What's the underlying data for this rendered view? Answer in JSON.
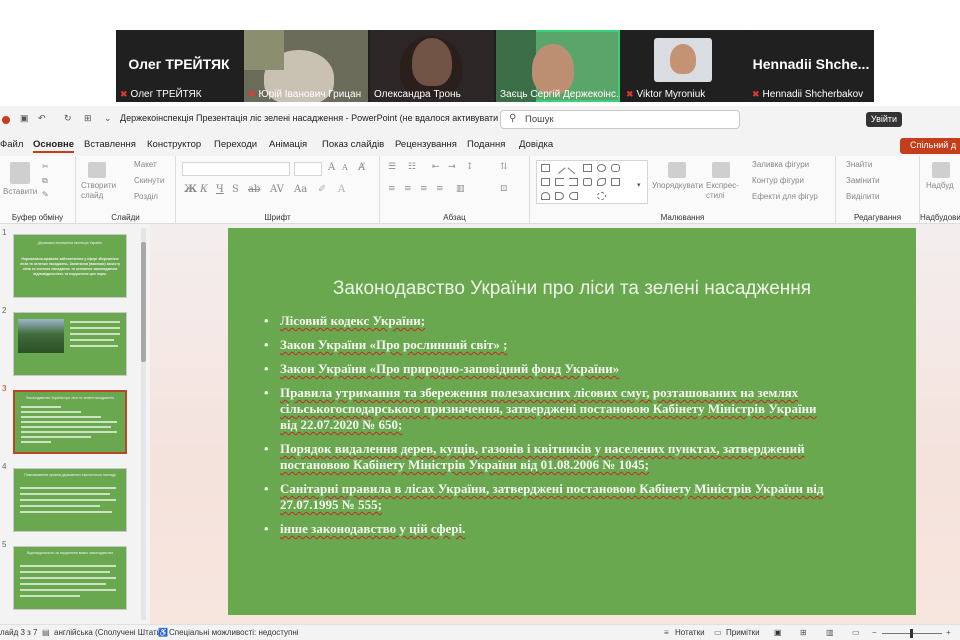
{
  "meeting": {
    "participants": [
      {
        "name": "Олег ТРЕЙТЯК",
        "big_name": "Олег ТРЕЙТЯК",
        "muted": true
      },
      {
        "name": "Юрій Іванович Грицан",
        "muted": true
      },
      {
        "name": "Олександра Тронь",
        "muted": false
      },
      {
        "name": "Заєць Сергій Держекоінс...",
        "muted": false,
        "active": true
      },
      {
        "name": "Viktor Myroniuk",
        "muted": true
      },
      {
        "name": "Hennadii Shcherbakov",
        "big_name": "Hennadii  Shche...",
        "muted": true
      }
    ]
  },
  "window": {
    "title": "Держекоінспекція Презентація ліс зелені насадження  -  PowerPoint (не вдалося активувати прод...",
    "search_placeholder": "Пошук",
    "signin_label": "Увійти",
    "share_label": "Спільний д"
  },
  "ribbon_tabs": [
    "Файл",
    "Основне",
    "Вставлення",
    "Конструктор",
    "Переходи",
    "Анімація",
    "Показ слайдів",
    "Рецензування",
    "Подання",
    "Довідка"
  ],
  "ribbon_groups": {
    "clipboard": {
      "label": "Буфер обміну",
      "paste": "Вставити"
    },
    "slides": {
      "label": "Слайди",
      "new_slide": "Створити слайд",
      "layout": "Макет",
      "reset": "Скинути",
      "section": "Розділ"
    },
    "font": {
      "label": "Шрифт"
    },
    "paragraph": {
      "label": "Абзац"
    },
    "drawing": {
      "label": "Малювання",
      "arrange": "Упорядкувати",
      "quick_styles": "Експрес-стилі",
      "fill": "Заливка фігури",
      "outline": "Контур фігури",
      "effects": "Ефекти для фігур"
    },
    "editing": {
      "label": "Редагування",
      "find": "Знайти",
      "replace": "Замінити",
      "select": "Виділити"
    },
    "addins": {
      "label": "Надбудови",
      "button": "Надбуд"
    }
  },
  "thumbnails": [
    {
      "num": "1",
      "title": "Державна екологічна інспекція України",
      "text": "Нормативно-правове забезпечення у сфері збереження лісів та зелених насаджень. Запитання (виклики) захисту лісів та зелених насаджень та основних законодавчих відповідальність та порушення цих норм."
    },
    {
      "num": "2",
      "title": "",
      "text": ""
    },
    {
      "num": "3",
      "title": "Законодавство України про ліси та зелені насадження",
      "text": ""
    },
    {
      "num": "4",
      "title": "Повноваження органів державного екологічного нагляду",
      "text": ""
    },
    {
      "num": "5",
      "title": "Відповідальність за порушення вимог законодавства",
      "text": ""
    }
  ],
  "slide": {
    "title": "Законодавство України про ліси та зелені насадження",
    "bullets": [
      "Лісовий кодекс України;",
      "Закон України «Про рослинний світ» ;",
      "Закон України «Про природно-заповідний фонд України»",
      "Правила утримання та збереження полезахисних лісових смуг, розташованих на землях сільськогосподарського призначення, затверджені постановою Кабінету Міністрів України від 22.07.2020 № 650;",
      "Порядок видалення дерев, кущів, газонів і квітників у населених пунктах, затверджений постановою Кабінету Міністрів України від 01.08.2006 № 1045;",
      "Санітарні правила в лісах України, затверджені постановою Кабінету Міністрів України від 27.07.1995 № 555;",
      "інше законодавство у цій сфері."
    ]
  },
  "statusbar": {
    "slide_info": "лайд 3 з 7",
    "language": "англійська (Сполучені Штати)",
    "accessibility": "Спеціальні можливості: недоступні",
    "notes": "Нотатки",
    "comments": "Примітки"
  },
  "colors": {
    "slide_bg": "#6aa84f",
    "accent": "#c43e1c",
    "active_speaker": "#38d27a"
  }
}
